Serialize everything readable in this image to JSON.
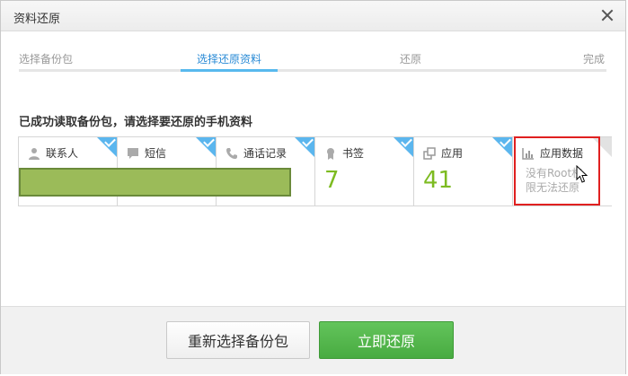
{
  "window": {
    "title": "资料还原"
  },
  "steps": [
    {
      "label": "选择备份包"
    },
    {
      "label": "选择还原资料"
    },
    {
      "label": "还原"
    },
    {
      "label": "完成"
    }
  ],
  "prompt": "已成功读取备份包，请选择要还原的手机资料",
  "cards": [
    {
      "label": "联系人",
      "icon": "person-icon",
      "count": "",
      "note": ""
    },
    {
      "label": "短信",
      "icon": "message-icon",
      "count": "",
      "note": ""
    },
    {
      "label": "通话记录",
      "icon": "phone-icon",
      "count": "",
      "note": ""
    },
    {
      "label": "书签",
      "icon": "bookmark-icon",
      "count": "7",
      "note": ""
    },
    {
      "label": "应用",
      "icon": "apps-icon",
      "count": "41",
      "note": ""
    },
    {
      "label": "应用数据",
      "icon": "chart-icon",
      "count": "",
      "note_line1": "没有Root权",
      "note_line2": "限无法还原"
    }
  ],
  "footer": {
    "reselect_label": "重新选择备份包",
    "restore_label": "立即还原"
  },
  "colors": {
    "accent_blue": "#58b9ee",
    "count_green": "#7dbb21",
    "primary_green": "#48ab41",
    "highlight_red": "#e02020"
  }
}
